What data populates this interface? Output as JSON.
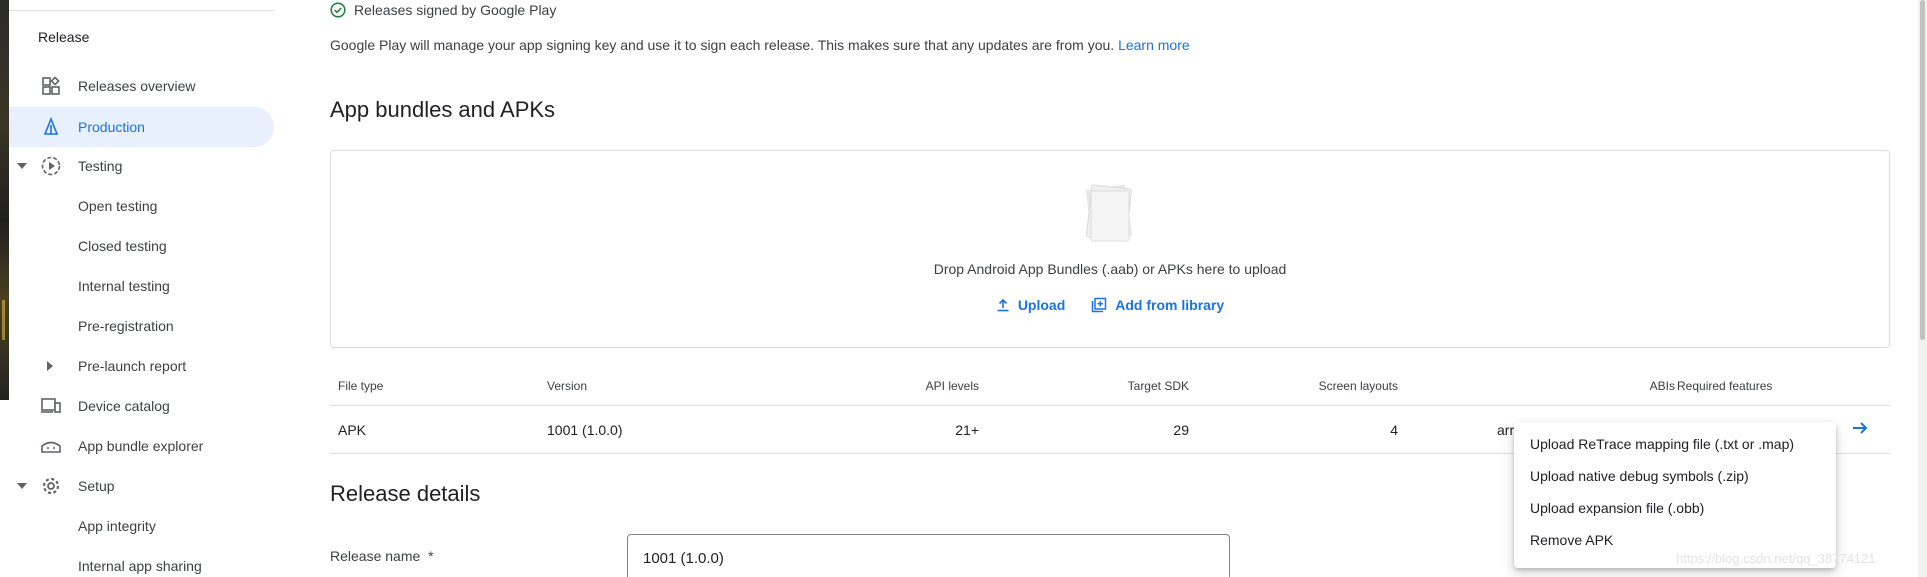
{
  "sidebar": {
    "section_title": "Release",
    "items": [
      {
        "label": "Releases overview",
        "icon": "dashboard-icon",
        "active": false
      },
      {
        "label": "Production",
        "icon": "production-icon",
        "active": true
      },
      {
        "label": "Testing",
        "icon": "testing-icon",
        "active": false,
        "expanded": true
      },
      {
        "label": "Open testing"
      },
      {
        "label": "Closed testing"
      },
      {
        "label": "Internal testing"
      },
      {
        "label": "Pre-registration"
      },
      {
        "label": "Pre-launch report",
        "collapsed": true
      },
      {
        "label": "Device catalog",
        "icon": "devices-icon"
      },
      {
        "label": "App bundle explorer",
        "icon": "app-bundle-icon"
      },
      {
        "label": "Setup",
        "icon": "gear-icon",
        "expanded": true
      },
      {
        "label": "App integrity"
      },
      {
        "label": "Internal app sharing"
      }
    ]
  },
  "signing": {
    "title": "Releases signed by Google Play",
    "description": "Google Play will manage your app signing key and use it to sign each release. This makes sure that any updates are from you.",
    "learn_more": "Learn more"
  },
  "bundles": {
    "heading": "App bundles and APKs",
    "drop_text": "Drop Android App Bundles (.aab) or APKs here to upload",
    "upload_label": "Upload",
    "library_label": "Add from library"
  },
  "table": {
    "headers": {
      "file_type": "File type",
      "version": "Version",
      "api_levels": "API levels",
      "target_sdk": "Target SDK",
      "screen_layouts": "Screen layouts",
      "abis": "ABIs",
      "required_features": "Required features"
    },
    "row": {
      "file_type": "APK",
      "version": "1001 (1.0.0)",
      "api_levels": "21+",
      "target_sdk": "29",
      "screen_layouts": "4",
      "abis": "arr"
    }
  },
  "context_menu": {
    "items": [
      "Upload ReTrace mapping file (.txt or .map)",
      "Upload native debug symbols (.zip)",
      "Upload expansion file (.obb)",
      "Remove APK"
    ]
  },
  "release_details": {
    "heading": "Release details",
    "name_label": "Release name",
    "required_mark": "*",
    "name_value": "1001 (1.0.0)"
  },
  "watermark": "https://blog.csdn.net/qq_38774121",
  "colors": {
    "accent": "#1a73e8",
    "active_bg": "#e8f0fe",
    "success": "#188038"
  }
}
